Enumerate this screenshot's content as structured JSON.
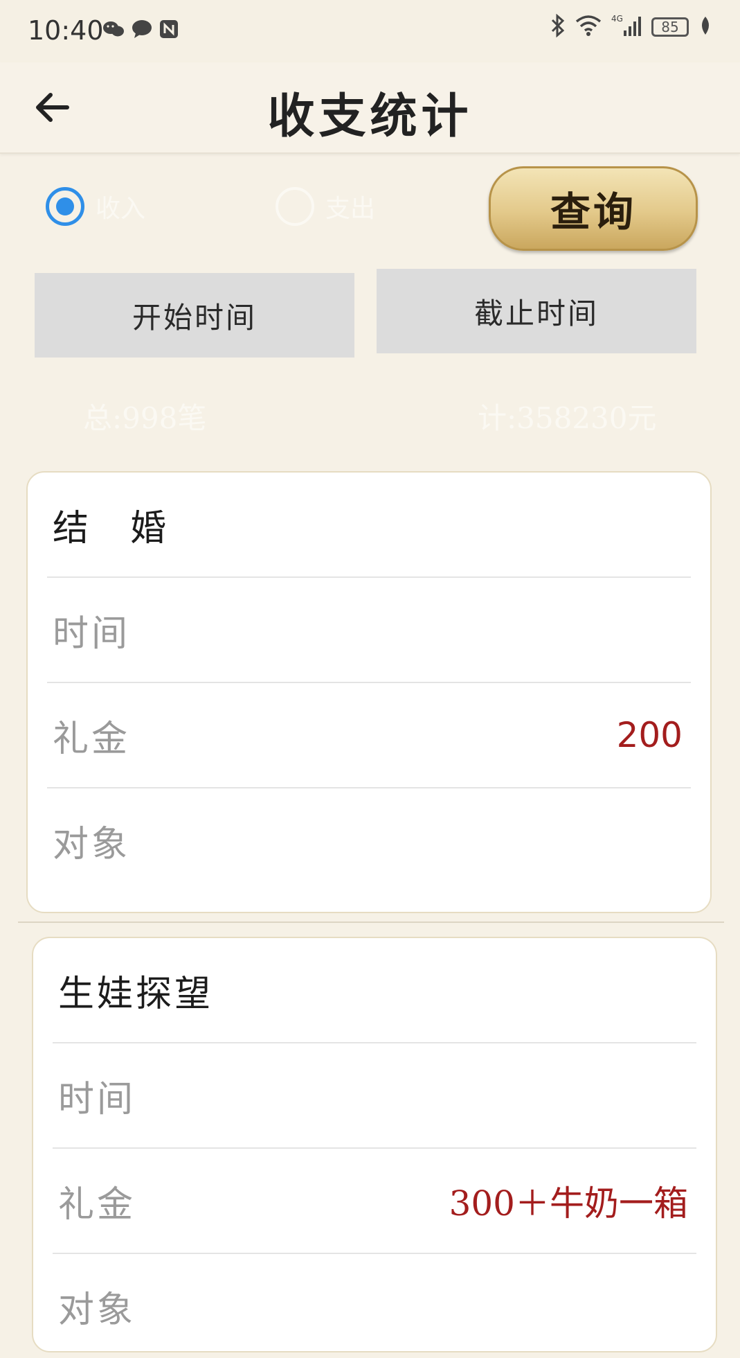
{
  "status_bar": {
    "time": "10:40",
    "battery": "85",
    "network": "4G",
    "icons": [
      "wechat-icon",
      "message-icon",
      "nfc-icon",
      "bluetooth-icon",
      "wifi-icon",
      "signal-icon",
      "battery-icon",
      "leaf-icon"
    ]
  },
  "header": {
    "title": "收支统计",
    "back_icon": "arrow-left-icon"
  },
  "filter": {
    "income_label": "收入",
    "expense_label": "支出",
    "selected": "income",
    "query_label": "查询",
    "start_time_label": "开始时间",
    "end_time_label": "截止时间"
  },
  "summary": {
    "count_text": "总:998笔",
    "total_text": "计:358230元"
  },
  "records": [
    {
      "title": "结　婚",
      "time_label": "时间",
      "time_value": "",
      "gift_label": "礼金",
      "gift_value": "200",
      "target_label": "对象",
      "target_value": ""
    },
    {
      "title": "生娃探望",
      "time_label": "时间",
      "time_value": "",
      "gift_label": "礼金",
      "gift_value": "300＋牛奶一箱",
      "target_label": "对象",
      "target_value": ""
    }
  ],
  "colors": {
    "background": "#f6f1e6",
    "accent_blue": "#2f8fe8",
    "value_red": "#a31d1d",
    "gold_button": "#e3c98a"
  }
}
